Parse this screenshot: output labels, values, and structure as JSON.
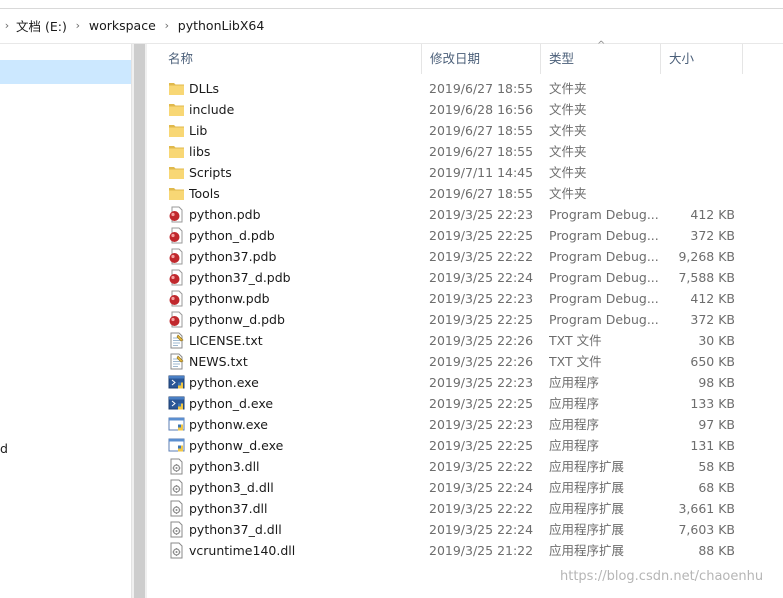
{
  "breadcrumb": {
    "items": [
      "文档 (E:)",
      "workspace",
      "pythonLibX64"
    ]
  },
  "navigation": {
    "truncated_item": "d"
  },
  "columns": {
    "name": "名称",
    "date": "修改日期",
    "type": "类型",
    "size": "大小"
  },
  "sort_icon": "chevron-up-icon",
  "files": [
    {
      "name": "DLLs",
      "date": "2019/6/27 18:55",
      "type": "文件夹",
      "size": "",
      "icon": "folder"
    },
    {
      "name": "include",
      "date": "2019/6/28 16:56",
      "type": "文件夹",
      "size": "",
      "icon": "folder"
    },
    {
      "name": "Lib",
      "date": "2019/6/27 18:55",
      "type": "文件夹",
      "size": "",
      "icon": "folder"
    },
    {
      "name": "libs",
      "date": "2019/6/27 18:55",
      "type": "文件夹",
      "size": "",
      "icon": "folder"
    },
    {
      "name": "Scripts",
      "date": "2019/7/11 14:45",
      "type": "文件夹",
      "size": "",
      "icon": "folder"
    },
    {
      "name": "Tools",
      "date": "2019/6/27 18:55",
      "type": "文件夹",
      "size": "",
      "icon": "folder"
    },
    {
      "name": "python.pdb",
      "date": "2019/3/25 22:23",
      "type": "Program Debug...",
      "size": "412 KB",
      "icon": "pdb"
    },
    {
      "name": "python_d.pdb",
      "date": "2019/3/25 22:25",
      "type": "Program Debug...",
      "size": "372 KB",
      "icon": "pdb"
    },
    {
      "name": "python37.pdb",
      "date": "2019/3/25 22:22",
      "type": "Program Debug...",
      "size": "9,268 KB",
      "icon": "pdb"
    },
    {
      "name": "python37_d.pdb",
      "date": "2019/3/25 22:24",
      "type": "Program Debug...",
      "size": "7,588 KB",
      "icon": "pdb"
    },
    {
      "name": "pythonw.pdb",
      "date": "2019/3/25 22:23",
      "type": "Program Debug...",
      "size": "412 KB",
      "icon": "pdb"
    },
    {
      "name": "pythonw_d.pdb",
      "date": "2019/3/25 22:25",
      "type": "Program Debug...",
      "size": "372 KB",
      "icon": "pdb"
    },
    {
      "name": "LICENSE.txt",
      "date": "2019/3/25 22:26",
      "type": "TXT 文件",
      "size": "30 KB",
      "icon": "txt"
    },
    {
      "name": "NEWS.txt",
      "date": "2019/3/25 22:26",
      "type": "TXT 文件",
      "size": "650 KB",
      "icon": "txt"
    },
    {
      "name": "python.exe",
      "date": "2019/3/25 22:23",
      "type": "应用程序",
      "size": "98 KB",
      "icon": "exe-console"
    },
    {
      "name": "python_d.exe",
      "date": "2019/3/25 22:25",
      "type": "应用程序",
      "size": "133 KB",
      "icon": "exe-console"
    },
    {
      "name": "pythonw.exe",
      "date": "2019/3/25 22:23",
      "type": "应用程序",
      "size": "97 KB",
      "icon": "exe-window"
    },
    {
      "name": "pythonw_d.exe",
      "date": "2019/3/25 22:25",
      "type": "应用程序",
      "size": "131 KB",
      "icon": "exe-window"
    },
    {
      "name": "python3.dll",
      "date": "2019/3/25 22:22",
      "type": "应用程序扩展",
      "size": "58 KB",
      "icon": "dll"
    },
    {
      "name": "python3_d.dll",
      "date": "2019/3/25 22:24",
      "type": "应用程序扩展",
      "size": "68 KB",
      "icon": "dll"
    },
    {
      "name": "python37.dll",
      "date": "2019/3/25 22:22",
      "type": "应用程序扩展",
      "size": "3,661 KB",
      "icon": "dll"
    },
    {
      "name": "python37_d.dll",
      "date": "2019/3/25 22:24",
      "type": "应用程序扩展",
      "size": "7,603 KB",
      "icon": "dll"
    },
    {
      "name": "vcruntime140.dll",
      "date": "2019/3/25 21:22",
      "type": "应用程序扩展",
      "size": "88 KB",
      "icon": "dll"
    }
  ],
  "watermark": "https://blog.csdn.net/chaoenhu",
  "colors": {
    "folder": "#f8d775",
    "folder_dark": "#e0b94d",
    "selection": "#cce8ff",
    "header_text": "#4c607a",
    "meta_text": "#6d6d6d"
  }
}
